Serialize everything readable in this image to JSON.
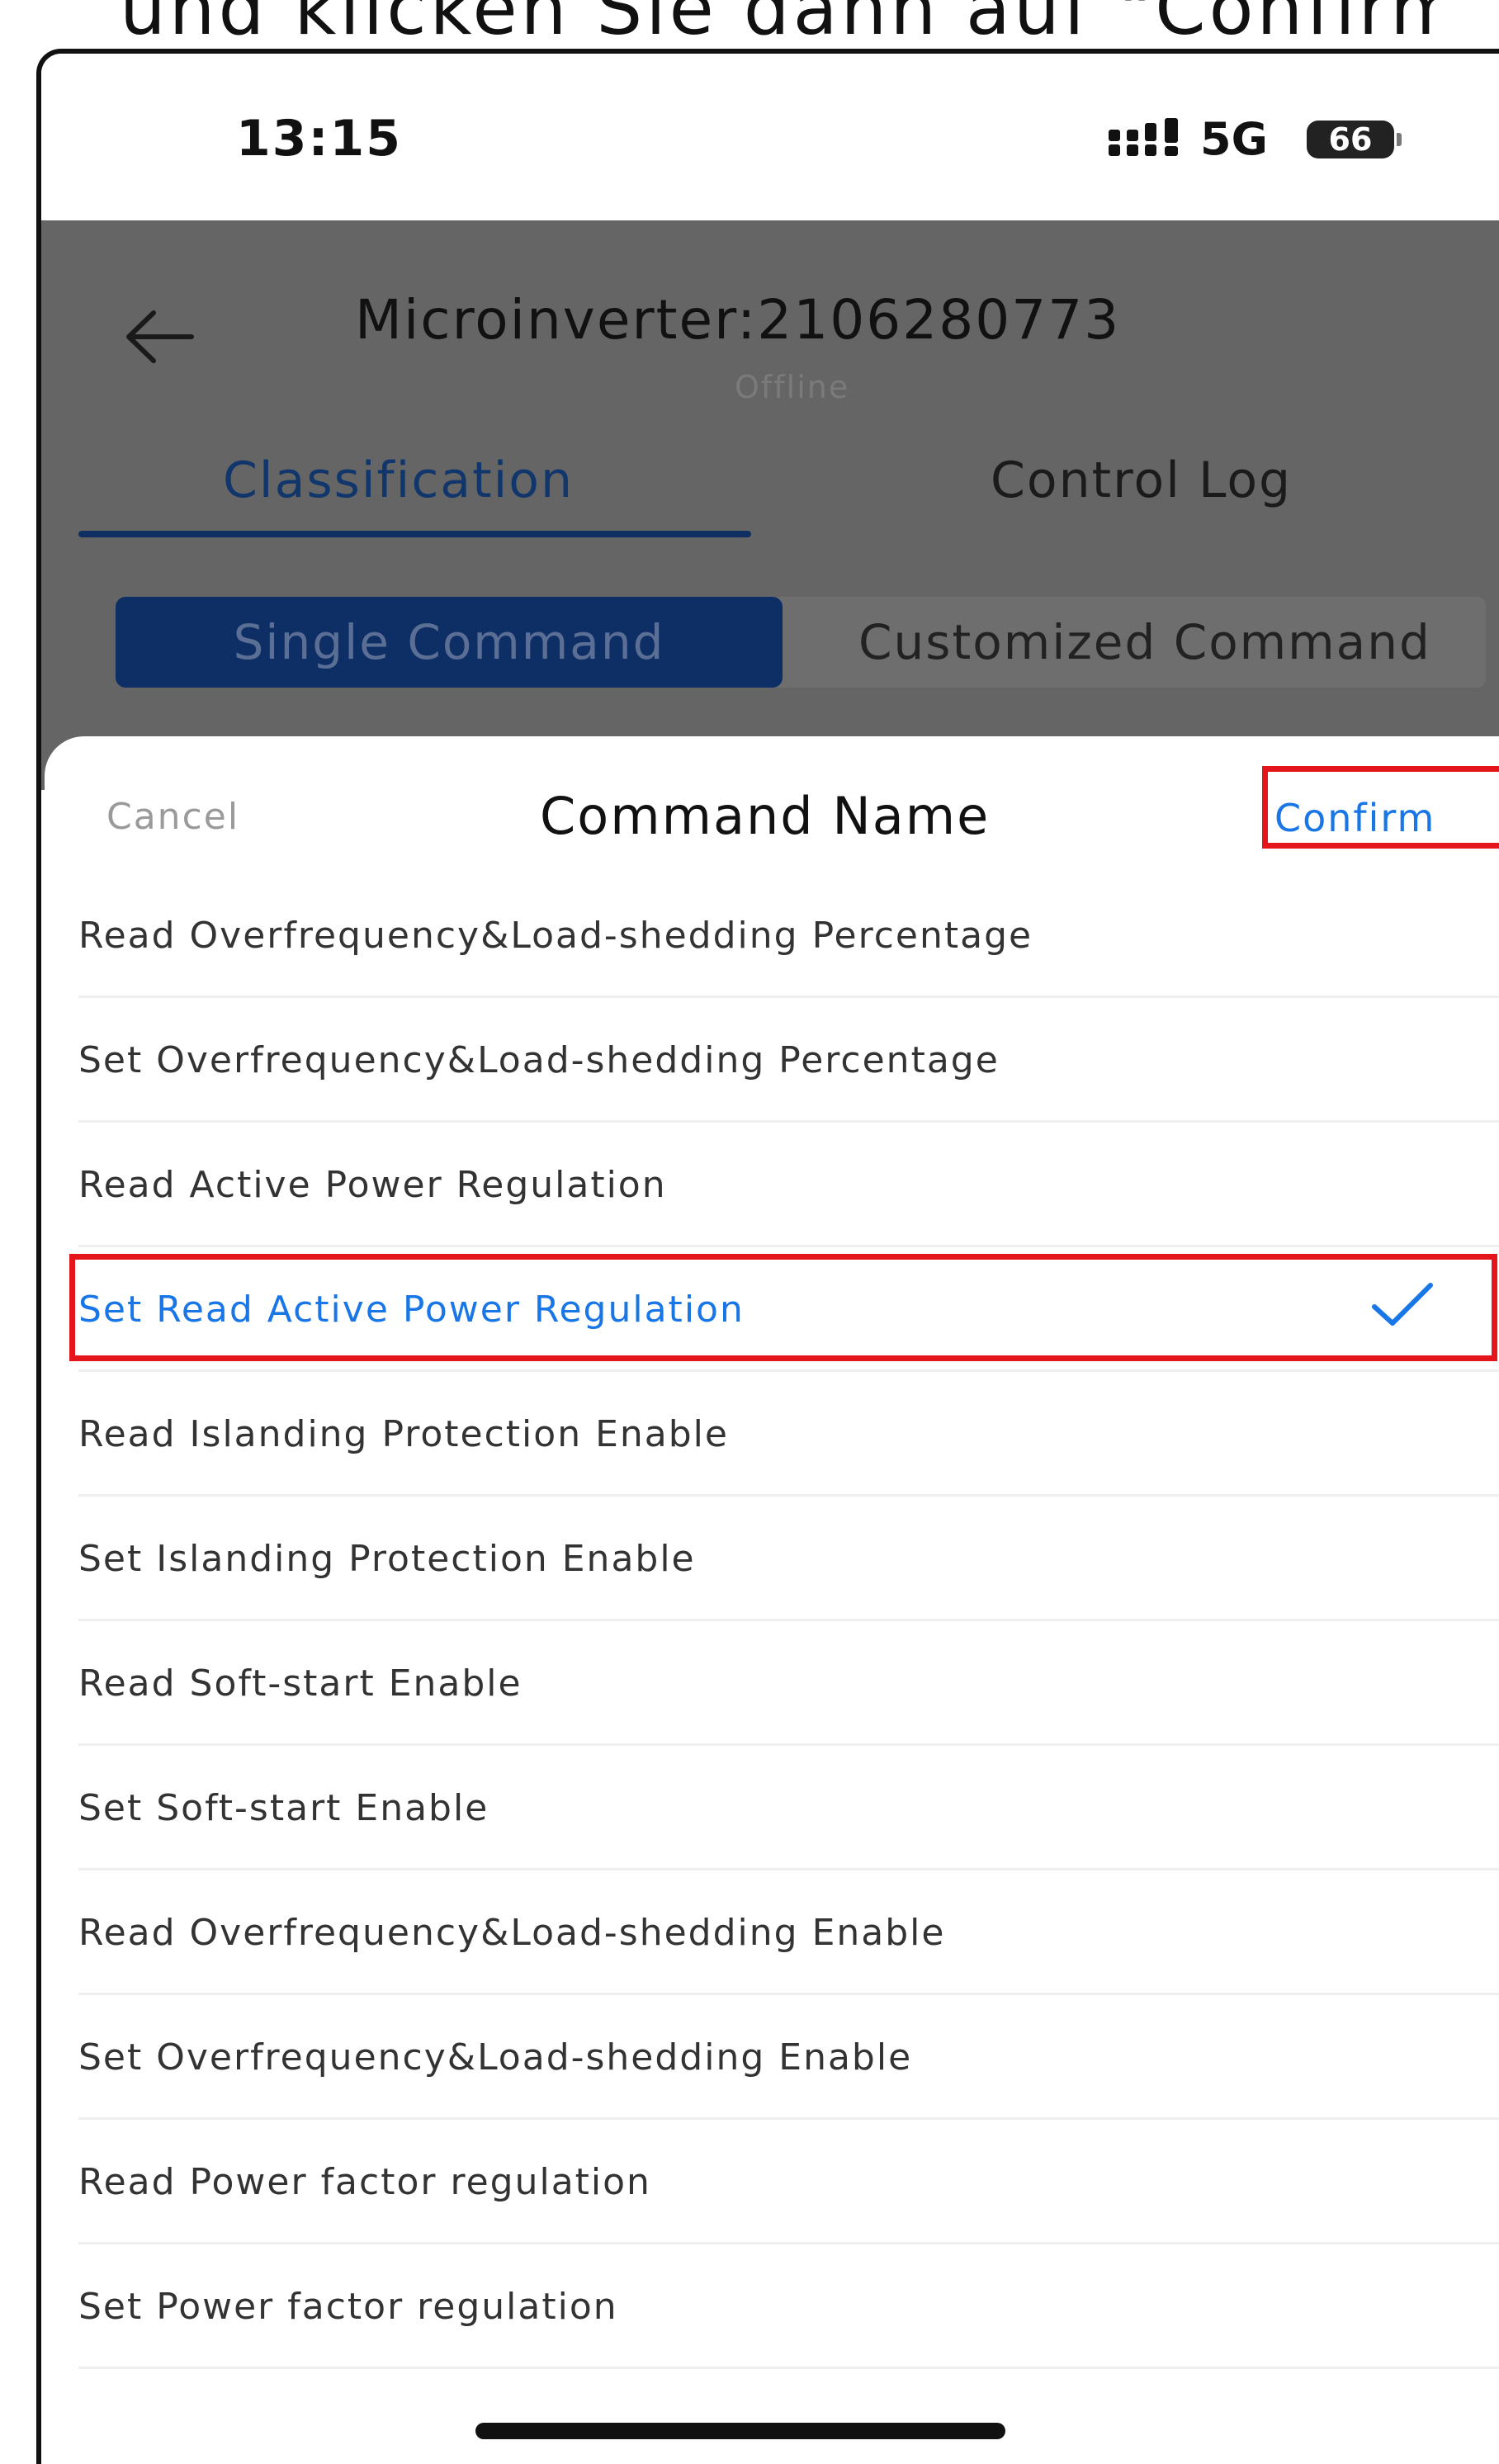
{
  "caption": "und klicken Sie dann auf \"Confirm\".",
  "status_bar": {
    "time": "13:15",
    "network": "5G",
    "battery": "66"
  },
  "header": {
    "title": "Microinverter:2106280773",
    "status": "Offline",
    "tabs": [
      {
        "label": "Classification",
        "active": true
      },
      {
        "label": "Control Log",
        "active": false
      }
    ],
    "segments": [
      {
        "label": "Single Command",
        "active": true
      },
      {
        "label": "Customized Command",
        "active": false
      }
    ]
  },
  "sheet": {
    "cancel_label": "Cancel",
    "title": "Command Name",
    "confirm_label": "Confirm",
    "items": [
      {
        "label": "Read Overfrequency&Load-shedding Percentage"
      },
      {
        "label": "Set Overfrequency&Load-shedding Percentage"
      },
      {
        "label": "Read Active Power Regulation"
      },
      {
        "label": "Set Read Active Power Regulation",
        "selected": true
      },
      {
        "label": "Read Islanding Protection Enable"
      },
      {
        "label": "Set Islanding Protection Enable"
      },
      {
        "label": "Read Soft-start Enable"
      },
      {
        "label": "Set Soft-start Enable"
      },
      {
        "label": "Read Overfrequency&Load-shedding Enable"
      },
      {
        "label": "Set Overfrequency&Load-shedding Enable"
      },
      {
        "label": "Read Power factor regulation"
      },
      {
        "label": "Set Power factor regulation"
      }
    ]
  },
  "colors": {
    "accent": "#1976e6",
    "highlight_border": "#e4161c",
    "header_bg": "#656565",
    "active_tab": "#11366c"
  },
  "icons": [
    "back-arrow-icon",
    "signal-icon",
    "battery-icon",
    "checkmark-icon"
  ]
}
